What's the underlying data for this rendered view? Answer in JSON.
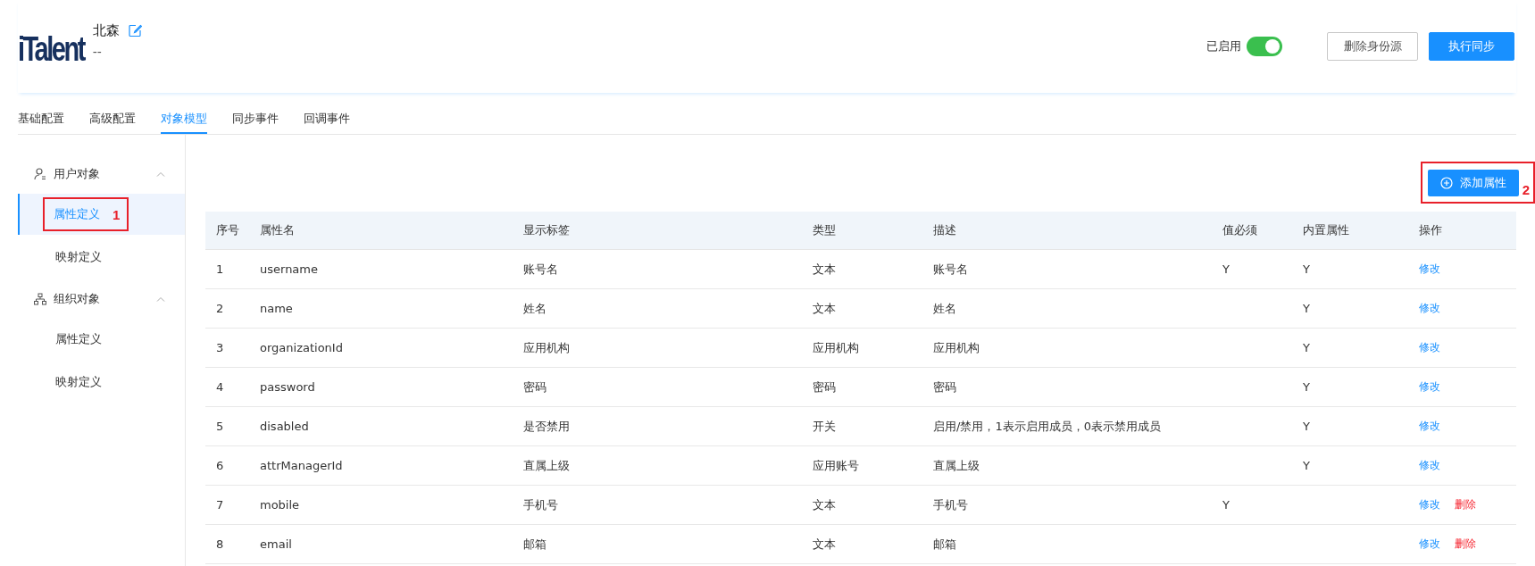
{
  "header": {
    "logo": "iTalent",
    "name": "北森",
    "subtitle": "--",
    "status_label": "已启用",
    "enabled": true,
    "buttons": [
      {
        "label": "删除身份源",
        "kind": "secondary"
      },
      {
        "label": "执行同步",
        "kind": "primary"
      }
    ]
  },
  "tabs": [
    {
      "label": "基础配置",
      "selected": false
    },
    {
      "label": "高级配置",
      "selected": false
    },
    {
      "label": "对象模型",
      "selected": true
    },
    {
      "label": "同步事件",
      "selected": false
    },
    {
      "label": "回调事件",
      "selected": false
    }
  ],
  "sidebar": {
    "groups": [
      {
        "label": "用户对象",
        "kind": "user",
        "expanded": true,
        "children": [
          {
            "label": "属性定义",
            "selected": true,
            "annotation": "1"
          },
          {
            "label": "映射定义",
            "selected": false
          }
        ]
      },
      {
        "label": "组织对象",
        "kind": "org",
        "expanded": true,
        "children": [
          {
            "label": "属性定义",
            "selected": false
          },
          {
            "label": "映射定义",
            "selected": false
          }
        ]
      }
    ]
  },
  "add_button": {
    "label": "添加属性",
    "annotation": "2"
  },
  "table": {
    "columns": [
      "序号",
      "属性名",
      "显示标签",
      "类型",
      "描述",
      "值必须",
      "内置属性",
      "操作"
    ],
    "rows": [
      {
        "cells": [
          "1",
          "username",
          "账号名",
          "文本",
          "账号名",
          "Y",
          "Y"
        ],
        "actions": [
          "修改"
        ]
      },
      {
        "cells": [
          "2",
          "name",
          "姓名",
          "文本",
          "姓名",
          "",
          "Y"
        ],
        "actions": [
          "修改"
        ]
      },
      {
        "cells": [
          "3",
          "organizationId",
          "应用机构",
          "应用机构",
          "应用机构",
          "",
          "Y"
        ],
        "actions": [
          "修改"
        ]
      },
      {
        "cells": [
          "4",
          "password",
          "密码",
          "密码",
          "密码",
          "",
          "Y"
        ],
        "actions": [
          "修改"
        ]
      },
      {
        "cells": [
          "5",
          "disabled",
          "是否禁用",
          "开关",
          "启用/禁用，1表示启用成员，0表示禁用成员",
          "",
          "Y"
        ],
        "actions": [
          "修改"
        ]
      },
      {
        "cells": [
          "6",
          "attrManagerId",
          "直属上级",
          "应用账号",
          "直属上级",
          "",
          "Y"
        ],
        "actions": [
          "修改"
        ]
      },
      {
        "cells": [
          "7",
          "mobile",
          "手机号",
          "文本",
          "手机号",
          "Y",
          ""
        ],
        "actions": [
          "修改",
          "删除"
        ]
      },
      {
        "cells": [
          "8",
          "email",
          "邮箱",
          "文本",
          "邮箱",
          "",
          ""
        ],
        "actions": [
          "修改",
          "删除"
        ]
      }
    ]
  }
}
